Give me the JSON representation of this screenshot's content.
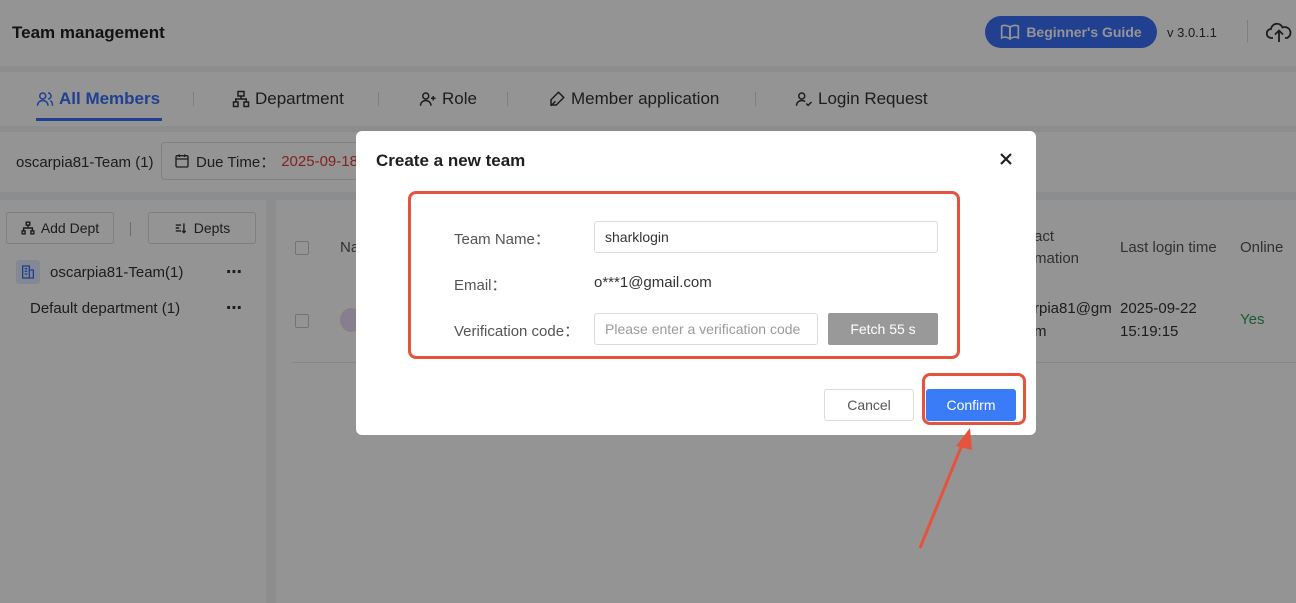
{
  "header": {
    "title": "Team management",
    "guide_label": "Beginner's Guide",
    "version": "v 3.0.1.1"
  },
  "tabs": [
    {
      "label": "All Members",
      "active": true
    },
    {
      "label": "Department",
      "active": false
    },
    {
      "label": "Role",
      "active": false
    },
    {
      "label": "Member application",
      "active": false
    },
    {
      "label": "Login Request",
      "active": false
    }
  ],
  "infobar": {
    "team": "oscarpia81-Team (1)",
    "due_label": "Due Time：",
    "due_date": "2025-09-18"
  },
  "sidebar": {
    "add_dept": "Add Dept",
    "depts": "Depts",
    "team_node": "oscarpia81-Team(1)",
    "default_dept": "Default department (1)",
    "more": "⋯"
  },
  "table": {
    "col_name_partial": "Na",
    "col_contact_1": "act",
    "col_contact_2": "mation",
    "col_last_login": "Last login time",
    "col_online": "Online",
    "row": {
      "contact_1": "rpia81@gm",
      "contact_2": "m",
      "login_date": "2025-09-22",
      "login_time": "15:19:15",
      "online": "Yes"
    }
  },
  "modal": {
    "title": "Create a new team",
    "team_name_label": "Team Name：",
    "team_name_value": "sharklogin",
    "email_label": "Email：",
    "email_value": "o***1@gmail.com",
    "code_label": "Verification code：",
    "code_placeholder": "Please enter a verification code",
    "fetch_label": "Fetch 55 s",
    "cancel_label": "Cancel",
    "confirm_label": "Confirm"
  },
  "colors": {
    "accent": "#3a6ff7",
    "highlight": "#e5533f",
    "online": "#2e9e5b",
    "due": "#e03b3b"
  }
}
